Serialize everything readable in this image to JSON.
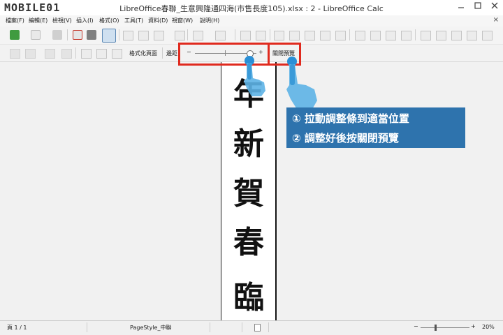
{
  "window": {
    "logo": "MOBILE01",
    "title": "LibreOffice春聯_生意興隆通四海(市售長度105).xlsx : 2 - LibreOffice Calc",
    "min_icon": "minimize-icon",
    "max_icon": "maximize-icon",
    "close_icon": "close-icon"
  },
  "menubar": {
    "items": [
      "檔案(F)",
      "編輯(E)",
      "檢視(V)",
      "插入(I)",
      "格式(O)",
      "工具(T)",
      "資料(D)",
      "視窗(W)",
      "說明(H)"
    ],
    "close_label": "×"
  },
  "preview_toolbar": {
    "format_page_label": "格式化頁面",
    "margins_label": "邊距",
    "zoom_minus": "−",
    "zoom_plus": "+",
    "close_preview_label": "關閉預覽"
  },
  "page_content": {
    "characters": [
      "年",
      "新",
      "賀",
      "春",
      "臨"
    ]
  },
  "callout": {
    "line1": "① 拉動調整條到適當位置",
    "line2": "② 調整好後按關閉預覽"
  },
  "statusbar": {
    "page_info": "頁 1 / 1",
    "page_style": "PageStyle_中聯",
    "zoom_level": "20%",
    "zoom_minus": "−",
    "zoom_plus": "+"
  },
  "colors": {
    "highlight_box": "#e02a1e",
    "callout_bg": "#2e73ad"
  }
}
